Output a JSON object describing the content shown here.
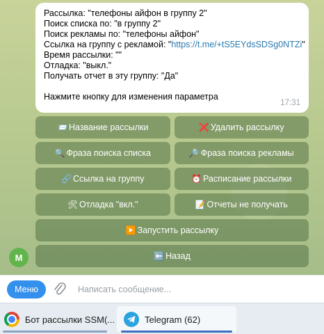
{
  "message": {
    "line1": "Рассылка: \"телефоны айфон в группу 2\"",
    "line2": "Поиск списка по: \"в группу 2\"",
    "line3": "Поиск рекламы по: \"телефоны айфон\"",
    "line4_prefix": "Ссылка на группу с рекламой: \"",
    "line4_link": "https://t.me/+tS5EYdsSDSg0NTZi",
    "line4_suffix": "\"",
    "line5": "Время рассылки: \"\"",
    "line6": "Отладка: \"выкл.\"",
    "line7": "Получать отчет в эту группу: \"Да\"",
    "line8": "Нажмите кнопку для изменения параметра",
    "time": "17:31"
  },
  "keyboard": {
    "rows": [
      [
        {
          "icon": "📨",
          "label": "Название рассылки"
        },
        {
          "icon": "❌",
          "label": "Удалить рассылку"
        }
      ],
      [
        {
          "icon": "🔍",
          "label": "Фраза поиска списка"
        },
        {
          "icon": "🔎",
          "label": "Фраза поиска рекламы"
        }
      ],
      [
        {
          "icon": "🔗",
          "label": "Ссылка на группу"
        },
        {
          "icon": "⏰",
          "label": "Расписание рассылки"
        }
      ],
      [
        {
          "icon": "🛠",
          "label": "Отладка \"вкл.\""
        },
        {
          "icon": "📝",
          "label": "Отчеты не получать"
        }
      ],
      [
        {
          "icon": "▶️",
          "label": "Запустить рассылку"
        }
      ],
      [
        {
          "icon": "⬅️",
          "label": "Назад"
        }
      ]
    ]
  },
  "avatar": {
    "letter": "M"
  },
  "input": {
    "menu_label": "Меню",
    "placeholder": "Написать сообщение..."
  },
  "taskbar": {
    "chrome_label": "Бот рассылки SSM(...",
    "telegram_label": "Telegram (62)"
  },
  "colors": {
    "accent": "#3390ec",
    "link": "#2a7ab0",
    "avatar": "#62b54c"
  }
}
